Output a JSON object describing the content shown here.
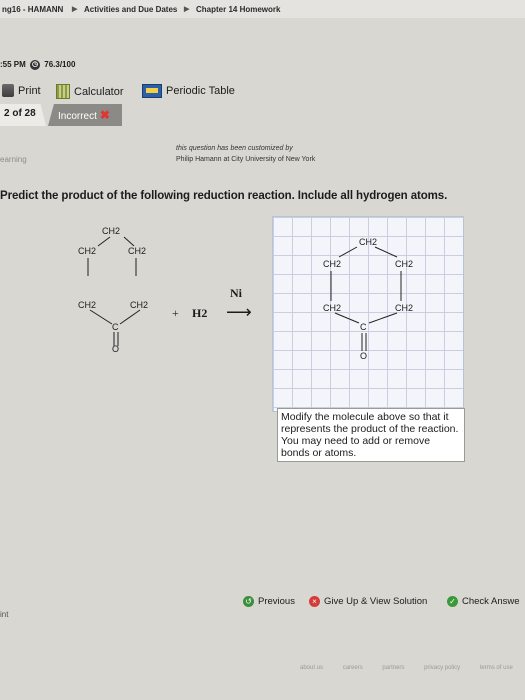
{
  "breadcrumb": {
    "course": "ng16 - HAMANN",
    "item1": "Activities and Due Dates",
    "item2": "Chapter 14 Homework"
  },
  "status": {
    "time": ":55 PM",
    "score": "76.3/100"
  },
  "toolbar": {
    "print": "Print",
    "calculator": "Calculator",
    "periodic_table": "Periodic Table"
  },
  "tabs": {
    "position": "2 of 28",
    "status": "Incorrect"
  },
  "side_label": "earning",
  "note": {
    "customized": "this question has been customized by",
    "by": "Philip Hamann at City University of New York"
  },
  "question": "Predict the product of the following reduction reaction. Include all hydrogen atoms.",
  "reactant": {
    "top": "CH2",
    "upper_left": "CH2",
    "upper_right": "CH2",
    "lower_left": "CH2",
    "lower_right": "CH2",
    "carbon": "C",
    "oxygen": "O",
    "plus": "+",
    "h2": "H2",
    "catalyst": "Ni",
    "arrow": "⟶"
  },
  "product": {
    "top": "CH2",
    "upper_left": "CH2",
    "upper_right": "CH2",
    "lower_left": "CH2",
    "lower_right": "CH2",
    "carbon": "C",
    "oxygen": "O"
  },
  "instruction": "Modify the molecule above so that it represents the product of the reaction. You may need to add or remove bonds or atoms.",
  "actions": {
    "previous": "Previous",
    "give_up": "Give Up & View Solution",
    "check": "Check Answe"
  },
  "side_bottom": "int",
  "footer": [
    "about us",
    "careers",
    "partners",
    "privacy policy",
    "terms of use"
  ],
  "colors": {
    "incorrect": "#e3342f",
    "grid": "#c8d0e0"
  }
}
